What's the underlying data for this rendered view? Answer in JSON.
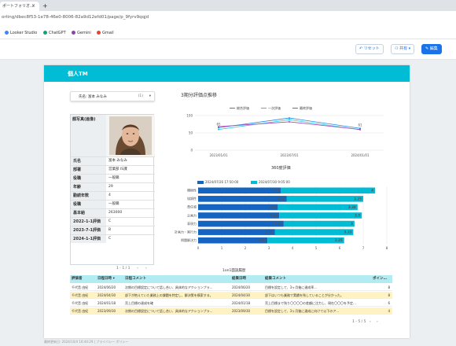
{
  "browser": {
    "tab_title": "ポートフォリオ…",
    "tab_close": "×",
    "tab_new": "+",
    "url": "orting/dbec8f53-1e78-46e0-8006-82a9d12efd01/page/p_9fyrv9qqjd",
    "bookmarks": [
      {
        "label": "Looker Studio",
        "color": "#4285f4"
      },
      {
        "label": "ChatGPT",
        "color": "#10a37f"
      },
      {
        "label": "Gemini",
        "color": "#8e44ad"
      },
      {
        "label": "Gmail",
        "color": "#ea4335"
      }
    ]
  },
  "toolbar": {
    "reset_label": "↶ リセット",
    "share_label": "⚇ 共有 ▾",
    "edit_label": "✎ 編集"
  },
  "report": {
    "title": "個人TM",
    "dropdown": {
      "label": "氏名: 富本 みなみ",
      "count": "(1)",
      "arrow": "▾"
    },
    "profile": {
      "photo_header": "顔写真(画像)",
      "rows": [
        {
          "key": "氏名",
          "value": "富本 みなみ"
        },
        {
          "key": "部署",
          "value": "営業部 IS課"
        },
        {
          "key": "役職",
          "value": "一般職"
        },
        {
          "key": "年齢",
          "value": "29"
        },
        {
          "key": "勤続年数",
          "value": "4"
        },
        {
          "key": "役職",
          "value": "一般職"
        },
        {
          "key": "基本給",
          "value": "263000"
        },
        {
          "key": "2022-1-1評価",
          "value": "C"
        },
        {
          "key": "2023-7-1評価",
          "value": "B"
        },
        {
          "key": "2024-1-1評価",
          "value": "C"
        }
      ],
      "pager": "1 - 1 / 1"
    },
    "line_chart": {
      "title": "3期分評価点推移",
      "legend": [
        {
          "label": "総合評価",
          "color": "#1e88e5"
        },
        {
          "label": "一次評価",
          "color": "#26c6da"
        },
        {
          "label": "最終評価",
          "color": "#ab47bc"
        }
      ]
    },
    "bar_chart": {
      "title": "360度評価",
      "legend": [
        {
          "label": "2024/07/26 17:50:00",
          "color": "#1565c0"
        },
        {
          "label": "2024/07/30 9:05:00",
          "color": "#00bcd4"
        }
      ]
    },
    "table": {
      "title": "1on1面談履歴",
      "headers": [
        "評価者",
        "日程日時 ▾",
        "日程コメント",
        "結果日時",
        "結果コメント",
        "ポイン…"
      ],
      "rows": [
        {
          "c1": "千代音 由紀",
          "c2": "2024/06/20",
          "c3": "次期の目標設定について話し合い、具体的なアクションプラ…",
          "c4": "2024/06/20",
          "c5": "目標を設定して、3ヶ月後に達成率…",
          "c6": "8",
          "hl": false
        },
        {
          "c1": "千代音 由紀",
          "c2": "2024/04/30",
          "c3": "部下が抱えていた業務上の課題を特定し、解決策を模索する。",
          "c4": "2024/04/30",
          "c5": "部下はいつも業務で実績を残していることが分かった。",
          "c6": "8",
          "hl": true
        },
        {
          "c1": "千代音 由紀",
          "c2": "2024/01/18",
          "c3": "売上目標の達成を確",
          "c4": "2024/01/18",
          "c5": "売上目標まで残り〇〇〇〇の差額に注力し、現在〇〇〇を予定…",
          "c6": "6",
          "hl": false
        },
        {
          "c1": "千代音 由紀",
          "c2": "2023/09/30",
          "c3": "次期の目標設定について話し合い、具体的なアクションプラ…",
          "c4": "2023/09/30",
          "c5": "目標を設定して、3ヶ月後に達成に向けて以下のア…",
          "c6": "4",
          "hl": true
        }
      ],
      "pager": "1 - 5 / 5"
    },
    "footer_note": "最終更新日: 2024/10/4 16:44:29 | プライバシー ポリシー"
  },
  "chart_data": [
    {
      "type": "line",
      "title": "3期分評価点推移",
      "x": [
        "2023/01/01",
        "2023/07/01",
        "2024/01/01"
      ],
      "ylim": [
        0,
        100
      ],
      "yticks": [
        0,
        50,
        100
      ],
      "series": [
        {
          "name": "総合評価",
          "color": "#1e88e5",
          "values": [
            65,
            93,
            63
          ]
        },
        {
          "name": "一次評価",
          "color": "#26c6da",
          "values": [
            60,
            88,
            59
          ]
        },
        {
          "name": "最終評価",
          "color": "#ab47bc",
          "values": [
            68,
            82,
            60
          ]
        }
      ],
      "labels": [
        {
          "series": 0,
          "index": 0,
          "text": "65"
        },
        {
          "series": 0,
          "index": 2,
          "text": "61"
        }
      ],
      "grid": true,
      "legend": "top"
    },
    {
      "type": "bar",
      "title": "360度評価",
      "categories": [
        "積極性",
        "協調性",
        "責任感",
        "企画力",
        "表現力",
        "計画力・実行力",
        "問題解決力"
      ],
      "xlim": [
        0,
        8
      ],
      "xticks": [
        0,
        1,
        2,
        3,
        4,
        5,
        6,
        7,
        8
      ],
      "series": [
        {
          "name": "2024/07/26 17:50:00",
          "color": "#1565c0",
          "values": [
            3.5,
            3.75,
            3.38,
            3.44,
            3.63,
            3.25,
            2.94
          ]
        },
        {
          "name": "2024/07/30 9:05:00",
          "color": "#00bcd4",
          "values": [
            4,
            3.25,
            3.38,
            3.5,
            3,
            3.33,
            3.25
          ]
        }
      ],
      "legend": "top"
    }
  ]
}
